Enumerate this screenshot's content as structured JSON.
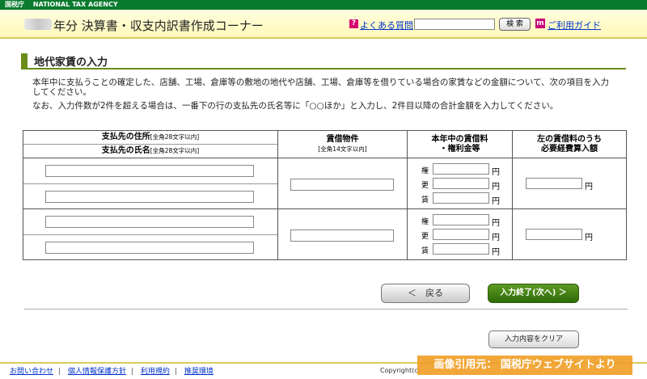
{
  "topbar": {
    "org_jp": "国税庁",
    "org_en": "NATIONAL TAX AGENCY"
  },
  "header": {
    "title": "年分 決算書・収支内訳書作成コーナー",
    "faq_link": "よくある質問",
    "search_button": "検 索",
    "guide_link": "ご利用ガイド"
  },
  "section": {
    "title": "地代家賃の入力"
  },
  "description": {
    "para1": "本年中に支払うことの確定した、店舗、工場、倉庫等の敷地の地代や店舗、工場、倉庫等を借りている場合の家賃などの金額について、次の項目を入力してください。",
    "para2": "なお、入力件数が2件を超える場合は、一番下の行の支払先の氏名等に「○○ほか」と入力し、2件目以降の合計金額を入力してください。"
  },
  "table": {
    "col1_line1": "支払先の住所",
    "col1_line1_note": "[全角28文字以内]",
    "col1_line2": "支払先の氏名",
    "col1_line2_note": "[全角28文字以内]",
    "col2": "賃借物件",
    "col2_note": "[全角14文字以内]",
    "col3_line1": "本年中の賃借料",
    "col3_line2": "・権利金等",
    "col4_line1": "左の賃借料のうち",
    "col4_line2": "必要経費算入額",
    "kenri": "権",
    "kousin": "更",
    "chin": "賃",
    "yen": "円"
  },
  "buttons": {
    "back": "＜　戻る",
    "next": "入力終了(次へ) ＞",
    "clear": "入力内容をクリア"
  },
  "footer": {
    "contact": "お問い合わせ",
    "privacy": "個人情報保護方針",
    "terms": "利用規約",
    "env": "推奨環境",
    "separator": "|",
    "copyright": "Copyright(c)",
    "watermark": "画像引用元： 国税庁ウェブサイトより"
  },
  "colors": {
    "brand_green": "#0a7a2e",
    "header_yellow": "#fff9b8",
    "section_green": "#6c8c1a",
    "link_blue": "#0033cc"
  }
}
